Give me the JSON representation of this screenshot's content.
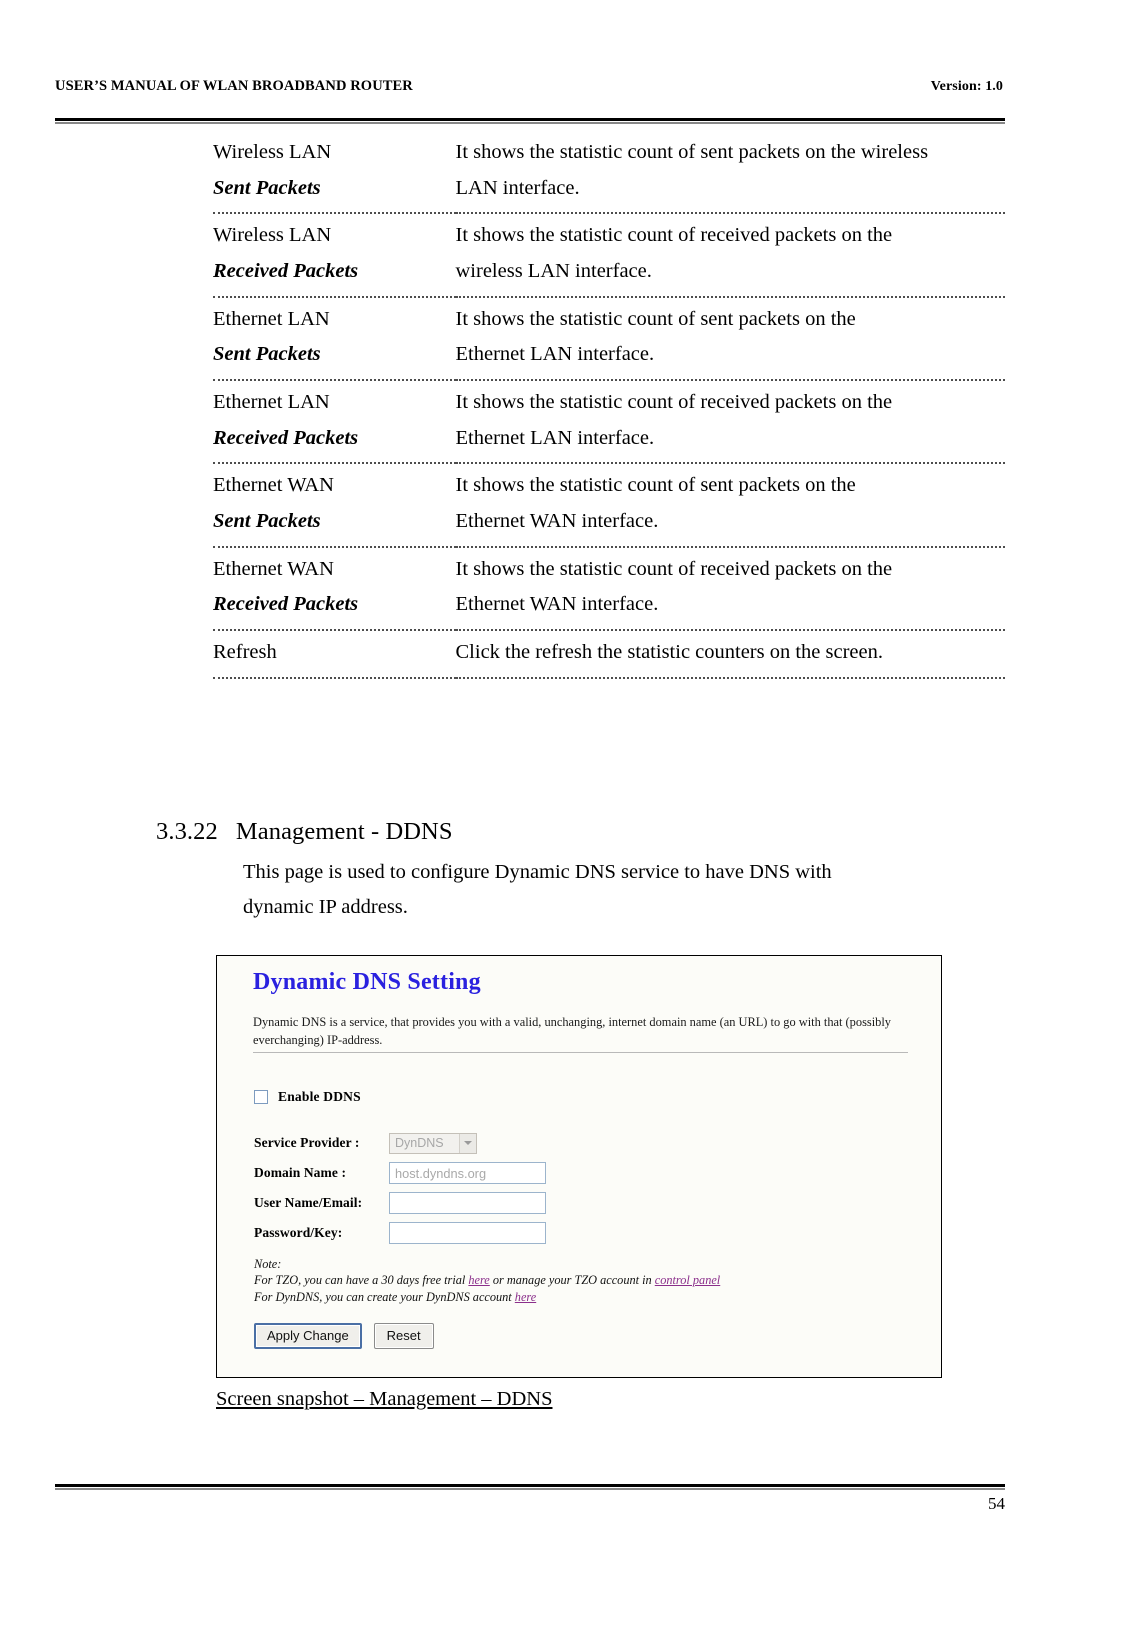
{
  "header": {
    "title": "USER’S MANUAL OF WLAN BROADBAND ROUTER",
    "version": "Version: 1.0"
  },
  "table": {
    "rows": [
      {
        "term_line1": "Wireless LAN",
        "term_line2": "Sent Packets",
        "desc_line1": "It shows the statistic count of sent packets on the wireless",
        "desc_line2": "LAN interface."
      },
      {
        "term_line1": "Wireless LAN",
        "term_line2": "Received Packets",
        "desc_line1": "It shows the statistic count of received packets on the",
        "desc_line2": "wireless LAN interface."
      },
      {
        "term_line1": "Ethernet LAN",
        "term_line2": "Sent Packets",
        "desc_line1": "It shows the statistic count of sent packets on the",
        "desc_line2": "Ethernet LAN interface."
      },
      {
        "term_line1": "Ethernet LAN",
        "term_line2": "Received Packets",
        "desc_line1": "It shows the statistic count of received packets on the",
        "desc_line2": "Ethernet LAN interface."
      },
      {
        "term_line1": "Ethernet WAN",
        "term_line2": "Sent Packets",
        "desc_line1": "It shows the statistic count of sent packets on the",
        "desc_line2": "Ethernet WAN interface."
      },
      {
        "term_line1": "Ethernet WAN",
        "term_line2": "Received Packets",
        "desc_line1": "It shows the statistic count of received packets on the",
        "desc_line2": "Ethernet WAN interface."
      },
      {
        "term_line1": "Refresh",
        "term_line2": "",
        "desc_line1": "Click the refresh the statistic counters on the screen.",
        "desc_line2": ""
      }
    ]
  },
  "section": {
    "number": "3.3.22",
    "title": "Management - DDNS",
    "body_line1": "This page is used to configure Dynamic DNS service to have DNS with",
    "body_line2": "dynamic IP address."
  },
  "screenshot": {
    "title": "Dynamic DNS  Setting",
    "description": "Dynamic DNS is a service, that provides you with a valid, unchanging, internet domain name (an URL) to go with that (possibly everchanging) IP-address.",
    "enable_checkbox_label": "Enable DDNS",
    "enable_checkbox_checked": false,
    "fields": [
      {
        "label": "Service Provider :",
        "type": "select",
        "value": "DynDNS",
        "disabled": true
      },
      {
        "label": "Domain Name :",
        "type": "text",
        "value": "host.dyndns.org",
        "disabled": true
      },
      {
        "label": "User Name/Email:",
        "type": "text",
        "value": "",
        "disabled": false
      },
      {
        "label": "Password/Key:",
        "type": "text",
        "value": "",
        "disabled": false
      }
    ],
    "note": {
      "heading": "Note:",
      "line1_a": "For TZO, you can have a 30 days free trial ",
      "line1_link1": "here",
      "line1_b": " or manage your TZO account in ",
      "line1_link2": "control panel",
      "line2_a": "For DynDNS, you can create your DynDNS account ",
      "line2_link1": "here"
    },
    "buttons": {
      "apply": "Apply Change",
      "reset": "Reset"
    },
    "colors": {
      "title_blue": "#2a21df",
      "link_purple": "#8b2f8b",
      "input_border": "#9cb4cc"
    }
  },
  "caption": "Screen snapshot – Management – DDNS",
  "footer": {
    "page_number": "54"
  }
}
